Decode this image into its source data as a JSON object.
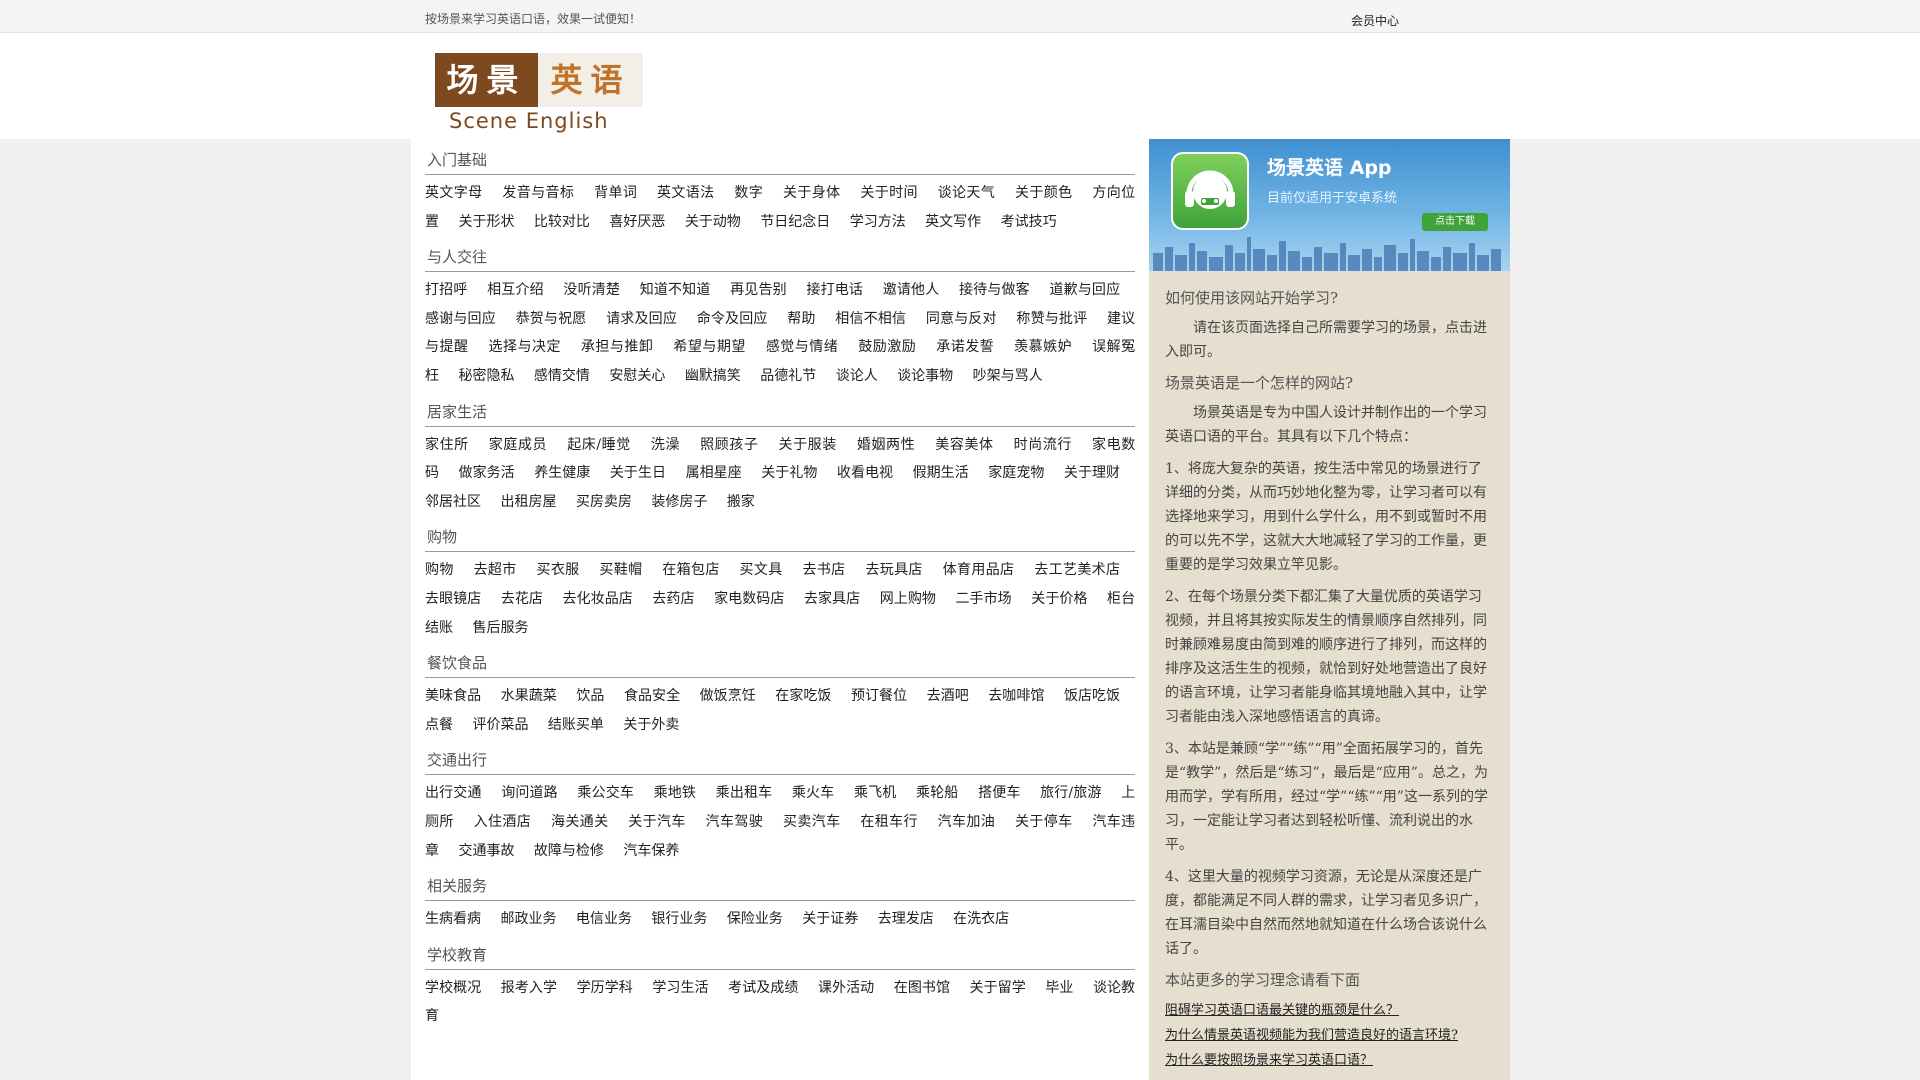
{
  "topbar": {
    "slogan": "按场景来学习英语口语，效果一试便知！",
    "member_center": "会员中心"
  },
  "logo": {
    "cn_part1": "场景",
    "cn_part2": "英语",
    "en": "Scene English"
  },
  "sections": [
    {
      "title": "入门基础",
      "items": [
        "英文字母",
        "发音与音标",
        "背单词",
        "英文语法",
        "数字",
        "关于身体",
        "关于时间",
        "谈论天气",
        "关于颜色",
        "方向位置",
        "关于形状",
        "比较对比",
        "喜好厌恶",
        "关于动物",
        "节日纪念日",
        "学习方法",
        "英文写作",
        "考试技巧"
      ]
    },
    {
      "title": "与人交往",
      "items": [
        "打招呼",
        "相互介绍",
        "没听清楚",
        "知道不知道",
        "再见告别",
        "接打电话",
        "邀请他人",
        "接待与做客",
        "道歉与回应",
        "感谢与回应",
        "恭贺与祝愿",
        "请求及回应",
        "命令及回应",
        "帮助",
        "相信不相信",
        "同意与反对",
        "称赞与批评",
        "建议与提醒",
        "选择与决定",
        "承担与推卸",
        "希望与期望",
        "感觉与情绪",
        "鼓励激励",
        "承诺发誓",
        "羡慕嫉妒",
        "误解冤枉",
        "秘密隐私",
        "感情交情",
        "安慰关心",
        "幽默搞笑",
        "品德礼节",
        "谈论人",
        "谈论事物",
        "吵架与骂人"
      ]
    },
    {
      "title": "居家生活",
      "items": [
        "家住所",
        "家庭成员",
        "起床/睡觉",
        "洗澡",
        "照顾孩子",
        "关于服装",
        "婚姻两性",
        "美容美体",
        "时尚流行",
        "家电数码",
        "做家务活",
        "养生健康",
        "关于生日",
        "属相星座",
        "关于礼物",
        "收看电视",
        "假期生活",
        "家庭宠物",
        "关于理财",
        "邻居社区",
        "出租房屋",
        "买房卖房",
        "装修房子",
        "搬家"
      ]
    },
    {
      "title": "购物",
      "items": [
        "购物",
        "去超市",
        "买衣服",
        "买鞋帽",
        "在箱包店",
        "买文具",
        "去书店",
        "去玩具店",
        "体育用品店",
        "去工艺美术店",
        "去眼镜店",
        "去花店",
        "去化妆品店",
        "去药店",
        "家电数码店",
        "去家具店",
        "网上购物",
        "二手市场",
        "关于价格",
        "柜台结账",
        "售后服务"
      ]
    },
    {
      "title": "餐饮食品",
      "items": [
        "美味食品",
        "水果蔬菜",
        "饮品",
        "食品安全",
        "做饭烹饪",
        "在家吃饭",
        "预订餐位",
        "去酒吧",
        "去咖啡馆",
        "饭店吃饭",
        "点餐",
        "评价菜品",
        "结账买单",
        "关于外卖"
      ]
    },
    {
      "title": "交通出行",
      "items": [
        "出行交通",
        "询问道路",
        "乘公交车",
        "乘地铁",
        "乘出租车",
        "乘火车",
        "乘飞机",
        "乘轮船",
        "搭便车",
        "旅行/旅游",
        "上厕所",
        "入住酒店",
        "海关通关",
        "关于汽车",
        "汽车驾驶",
        "买卖汽车",
        "在租车行",
        "汽车加油",
        "关于停车",
        "汽车违章",
        "交通事故",
        "故障与检修",
        "汽车保养"
      ]
    },
    {
      "title": "相关服务",
      "items": [
        "生病看病",
        "邮政业务",
        "电信业务",
        "银行业务",
        "保险业务",
        "关于证券",
        "去理发店",
        "在洗衣店"
      ]
    },
    {
      "title": "学校教育",
      "items": [
        "学校概况",
        "报考入学",
        "学历学科",
        "学习生活",
        "考试及成绩",
        "课外活动",
        "在图书馆",
        "关于留学",
        "毕业",
        "谈论教育"
      ]
    }
  ],
  "app_banner": {
    "title": "场景英语 App",
    "subtitle": "目前仅适用于安卓系统",
    "download": "点击下载"
  },
  "sidebar": {
    "q1": "如何使用该网站开始学习?",
    "a1": "请在该页面选择自己所需要学习的场景，点击进入即可。",
    "q2": "场景英语是一个怎样的网站?",
    "a2_intro": "场景英语是专为中国人设计并制作出的一个学习英语口语的平台。其具有以下几个特点：",
    "points": [
      "1、将庞大复杂的英语，按生活中常见的场景进行了详细的分类，从而巧妙地化整为零，让学习者可以有选择地来学习，用到什么学什么，用不到或暂时不用的可以先不学，这就大大地减轻了学习的工作量，更重要的是学习效果立竿见影。",
      "2、在每个场景分类下都汇集了大量优质的英语学习视频，并且将其按实际发生的情景顺序自然排列，同时兼顾难易度由简到难的顺序进行了排列，而这样的排序及这活生生的视频，就恰到好处地营造出了良好的语言环境，让学习者能身临其境地融入其中，让学习者能由浅入深地感悟语言的真谛。",
      "3、本站是兼顾“学”“练”“用”全面拓展学习的，首先是“教学”，然后是“练习”，最后是“应用”。总之，为用而学，学有所用，经过“学”“练”“用”这一系列的学习，一定能让学习者达到轻松听懂、流利说出的水平。",
      "4、这里大量的视频学习资源，无论是从深度还是广度，都能满足不同人群的需求，让学习者见多识广，在耳濡目染中自然而然地就知道在什么场合该说什么话了。"
    ],
    "q3": "本站更多的学习理念请看下面",
    "articles": [
      "阻碍学习英语口语最关键的瓶颈是什么？",
      "为什么情景英语视频能为我们营造良好的语言环境?",
      "为什么要按照场景来学习英语口语？"
    ]
  }
}
